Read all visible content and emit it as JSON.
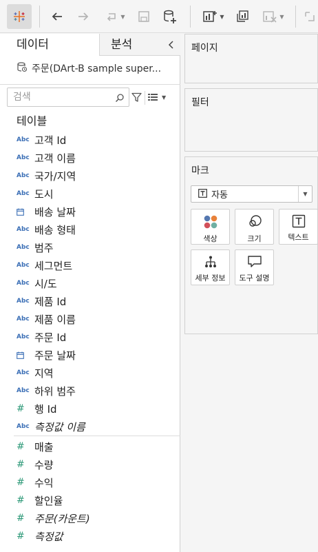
{
  "tabs": {
    "data": "데이터",
    "analysis": "분석"
  },
  "datasource": {
    "name": "주문(DArt-B sample super..."
  },
  "search": {
    "placeholder": "검색"
  },
  "tables": {
    "title": "테이블",
    "dimensions": [
      {
        "type": "Abc",
        "name": "고객 Id"
      },
      {
        "type": "Abc",
        "name": "고객 이름"
      },
      {
        "type": "Abc",
        "name": "국가/지역"
      },
      {
        "type": "Abc",
        "name": "도시"
      },
      {
        "type": "date",
        "name": "배송 날짜"
      },
      {
        "type": "Abc",
        "name": "배송 형태"
      },
      {
        "type": "Abc",
        "name": "범주"
      },
      {
        "type": "Abc",
        "name": "세그먼트"
      },
      {
        "type": "Abc",
        "name": "시/도"
      },
      {
        "type": "Abc",
        "name": "제품 Id"
      },
      {
        "type": "Abc",
        "name": "제품 이름"
      },
      {
        "type": "Abc",
        "name": "주문 Id"
      },
      {
        "type": "date",
        "name": "주문 날짜"
      },
      {
        "type": "Abc",
        "name": "지역"
      },
      {
        "type": "Abc",
        "name": "하위 범주"
      },
      {
        "type": "#",
        "name": "행 Id"
      },
      {
        "type": "Abc",
        "name": "측정값 이름"
      }
    ],
    "measures": [
      {
        "type": "#",
        "name": "매출"
      },
      {
        "type": "#",
        "name": "수량"
      },
      {
        "type": "#",
        "name": "수익"
      },
      {
        "type": "#",
        "name": "할인율"
      },
      {
        "type": "#",
        "name": "주문(카운트)"
      },
      {
        "type": "#",
        "name": "측정값"
      }
    ]
  },
  "cards": {
    "pages": "페이지",
    "filters": "필터",
    "marks": "마크"
  },
  "marks": {
    "type": "자동",
    "buttons": {
      "color": "색상",
      "size": "크기",
      "text": "텍스트",
      "detail": "세부 정보",
      "tooltip": "도구 설명"
    }
  },
  "colors": {
    "dimension": "#3b6fb6",
    "measure": "#2f9a79"
  }
}
